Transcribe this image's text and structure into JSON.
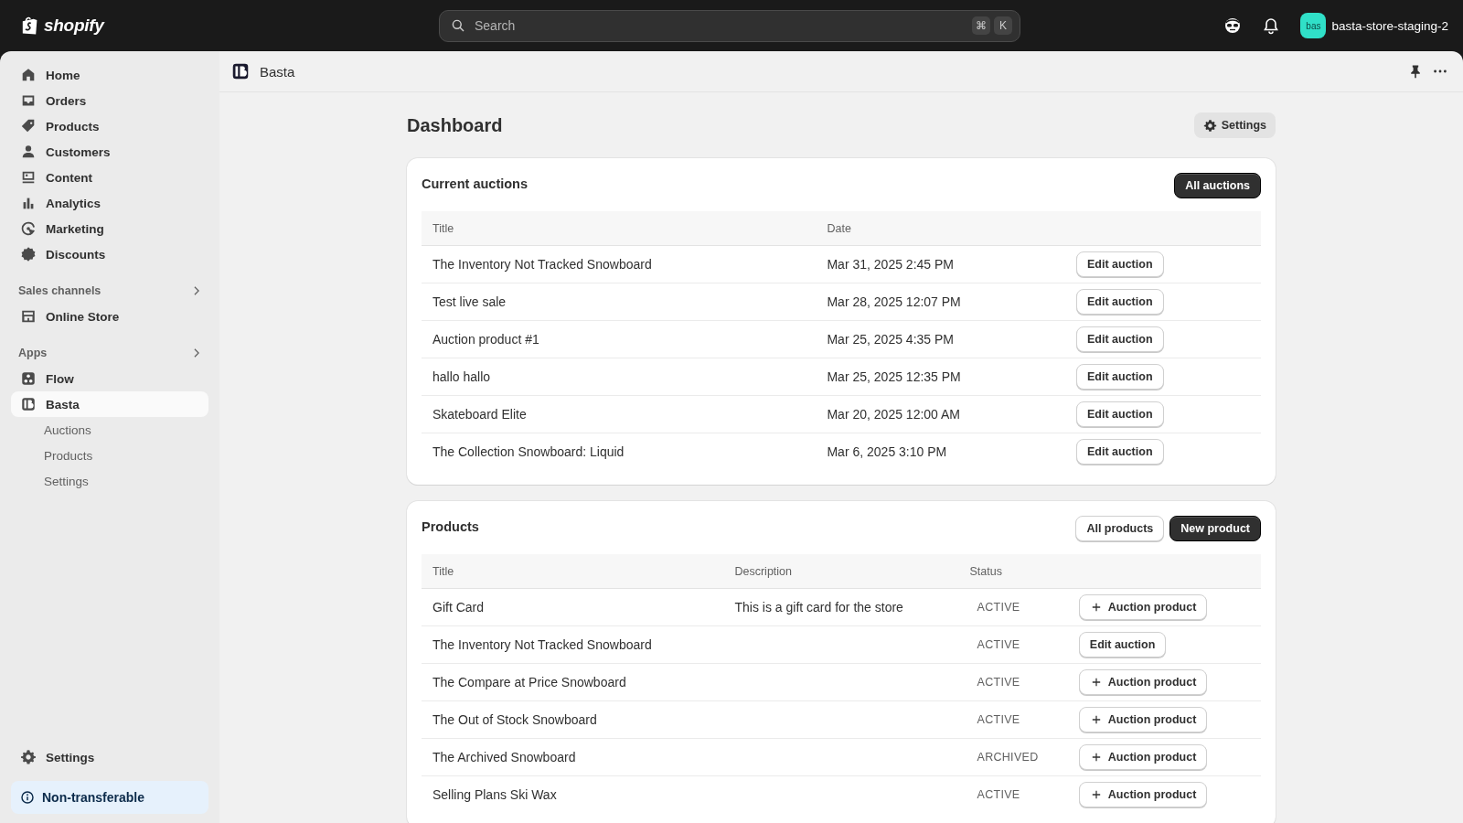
{
  "topbar": {
    "logo_text": "shopify",
    "search": {
      "placeholder": "Search"
    },
    "shortcut_keys": [
      "⌘",
      "K"
    ],
    "store": {
      "avatar": "bas",
      "name": "basta-store-staging-2"
    }
  },
  "sidebar": {
    "items": [
      {
        "label": "Home",
        "kind": "home",
        "selected": false
      },
      {
        "label": "Orders",
        "kind": "orders",
        "selected": false
      },
      {
        "label": "Products",
        "kind": "tag",
        "selected": false
      },
      {
        "label": "Customers",
        "kind": "person",
        "selected": false
      },
      {
        "label": "Content",
        "kind": "content",
        "selected": false
      },
      {
        "label": "Analytics",
        "kind": "analytics",
        "selected": false
      },
      {
        "label": "Marketing",
        "kind": "marketing",
        "selected": false
      },
      {
        "label": "Discounts",
        "kind": "discount",
        "selected": false
      }
    ],
    "sections": [
      {
        "title": "Sales channels",
        "items": [
          {
            "label": "Online Store",
            "kind": "store",
            "selected": false
          }
        ]
      },
      {
        "title": "Apps",
        "items": [
          {
            "label": "Flow",
            "kind": "flow",
            "selected": false
          },
          {
            "label": "Basta",
            "kind": "basta",
            "selected": true,
            "children": [
              {
                "label": "Auctions"
              },
              {
                "label": "Products"
              },
              {
                "label": "Settings"
              }
            ]
          }
        ]
      }
    ],
    "settings": {
      "label": "Settings"
    },
    "notice": {
      "label": "Non-transferable"
    }
  },
  "app_header": {
    "name": "Basta"
  },
  "page": {
    "title": "Dashboard",
    "settings_button": "Settings"
  },
  "auctions": {
    "title": "Current auctions",
    "buttons": [
      {
        "label": "All auctions",
        "kind": "primary"
      }
    ],
    "columns": [
      "Title",
      "Date"
    ],
    "rows": [
      {
        "title": "The Inventory Not Tracked Snowboard",
        "date": "Mar 31, 2025 2:45 PM",
        "action": "Edit auction"
      },
      {
        "title": "Test live sale",
        "date": "Mar 28, 2025 12:07 PM",
        "action": "Edit auction"
      },
      {
        "title": "Auction product #1",
        "date": "Mar 25, 2025 4:35 PM",
        "action": "Edit auction"
      },
      {
        "title": "hallo hallo",
        "date": "Mar 25, 2025 12:35 PM",
        "action": "Edit auction"
      },
      {
        "title": "Skateboard Elite",
        "date": "Mar 20, 2025 12:00 AM",
        "action": "Edit auction"
      },
      {
        "title": "The Collection Snowboard: Liquid",
        "date": "Mar 6, 2025 3:10 PM",
        "action": "Edit auction"
      }
    ]
  },
  "products": {
    "title": "Products",
    "buttons": [
      {
        "label": "All products",
        "kind": "secondary"
      },
      {
        "label": "New product",
        "kind": "primary"
      }
    ],
    "columns": [
      "Title",
      "Description",
      "Status"
    ],
    "rows": [
      {
        "title": "Gift Card",
        "description": "This is a gift card for the store",
        "status": "ACTIVE",
        "action": {
          "label": "Auction product",
          "kind": "add"
        }
      },
      {
        "title": "The Inventory Not Tracked Snowboard",
        "status": "ACTIVE",
        "action": {
          "label": "Edit auction",
          "kind": "edit"
        }
      },
      {
        "title": "The Compare at Price Snowboard",
        "status": "ACTIVE",
        "action": {
          "label": "Auction product",
          "kind": "add"
        }
      },
      {
        "title": "The Out of Stock Snowboard",
        "status": "ACTIVE",
        "action": {
          "label": "Auction product",
          "kind": "add"
        }
      },
      {
        "title": "The Archived Snowboard",
        "status": "ARCHIVED",
        "action": {
          "label": "Auction product",
          "kind": "add"
        }
      },
      {
        "title": "Selling Plans Ski Wax",
        "status": "ACTIVE",
        "action": {
          "label": "Auction product",
          "kind": "add"
        }
      }
    ]
  }
}
